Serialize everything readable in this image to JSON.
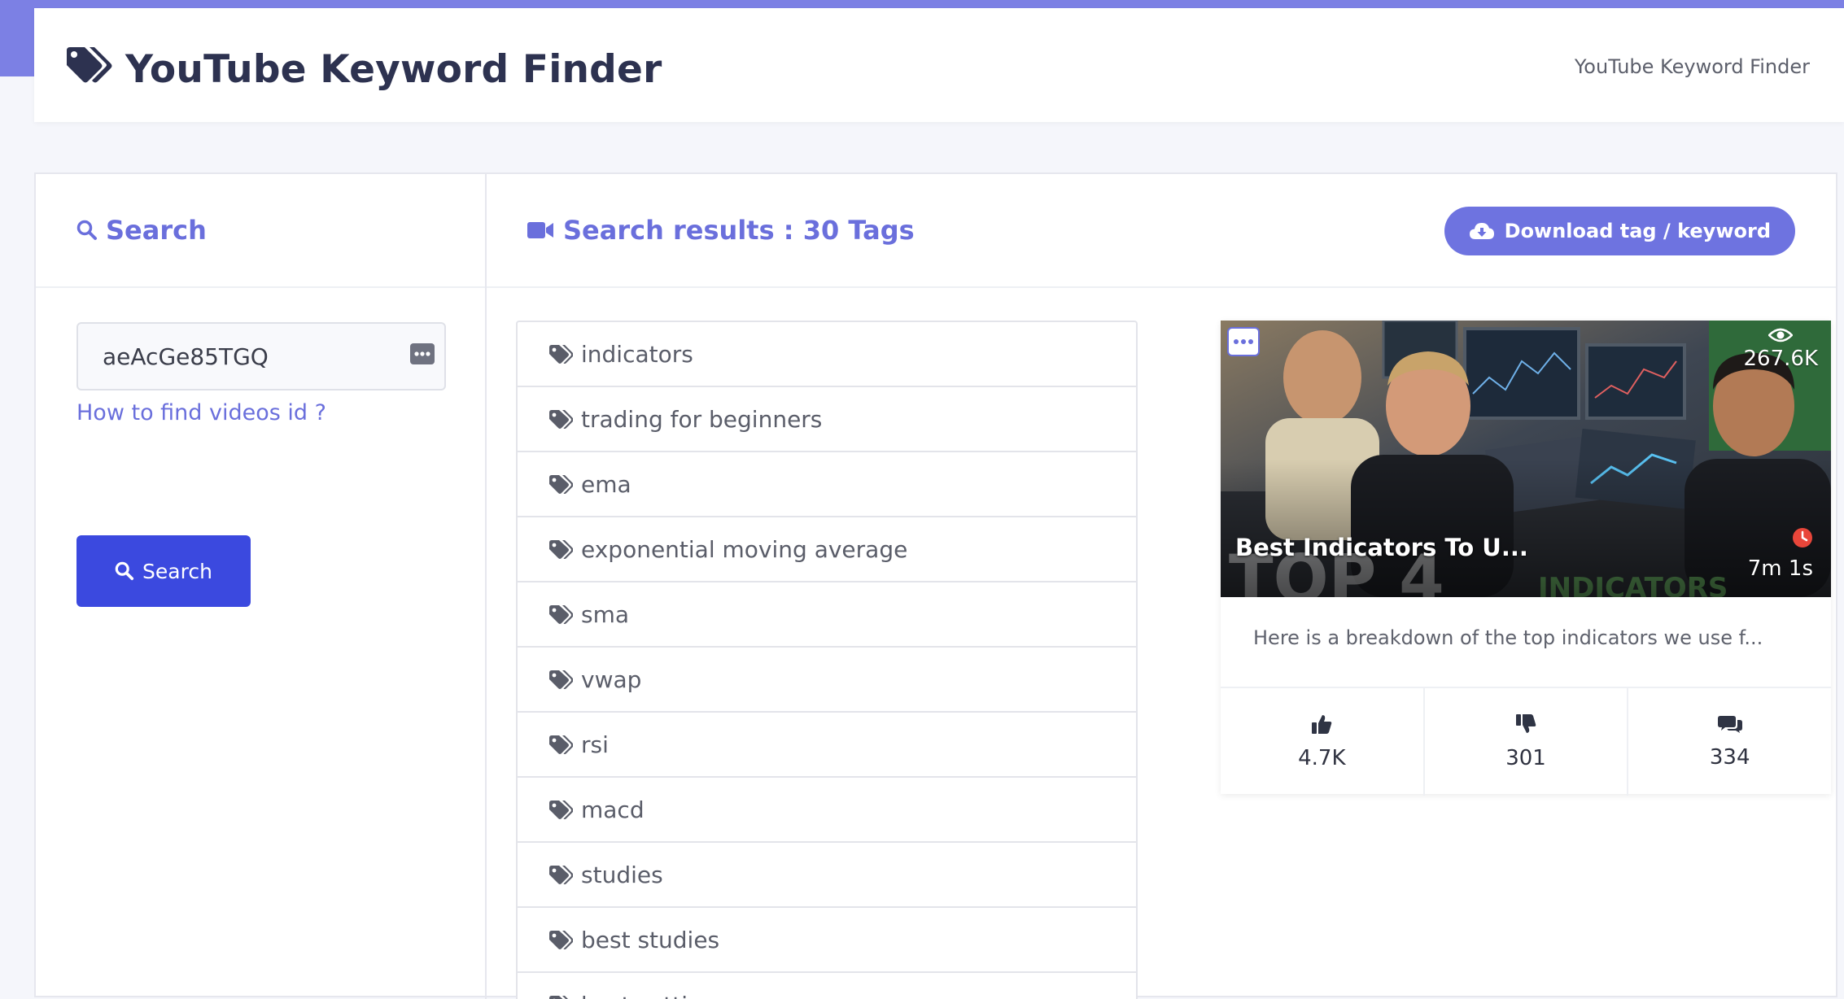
{
  "header": {
    "title": "YouTube Keyword Finder",
    "breadcrumb": "YouTube Keyword Finder"
  },
  "search_panel": {
    "title": "Search",
    "video_id_value": "aeAcGe85TGQ",
    "help_link": "How to find videos id ?",
    "search_button": "Search"
  },
  "results": {
    "title": "Search results : 30 Tags",
    "download_button": "Download tag / keyword",
    "tags": [
      "indicators",
      "trading for beginners",
      "ema",
      "exponential moving average",
      "sma",
      "vwap",
      "rsi",
      "macd",
      "studies",
      "best studies",
      "best settings"
    ]
  },
  "video": {
    "title": "Best Indicators To U...",
    "views": "267.6K",
    "duration": "7m 1s",
    "description": "Here is a breakdown of the top indicators we use f...",
    "likes": "4.7K",
    "dislikes": "301",
    "comments": "334"
  },
  "colors": {
    "accent": "#6a6fdc",
    "primary_button": "#3b49df",
    "download_button": "#6e73e0",
    "heading": "#2d3250"
  },
  "icons": [
    "tag-icon",
    "search-icon",
    "video-camera-icon",
    "cloud-download-icon",
    "password-key-icon",
    "eye-icon",
    "clock-icon",
    "thumbs-up-icon",
    "thumbs-down-icon",
    "comments-icon",
    "more-icon"
  ]
}
